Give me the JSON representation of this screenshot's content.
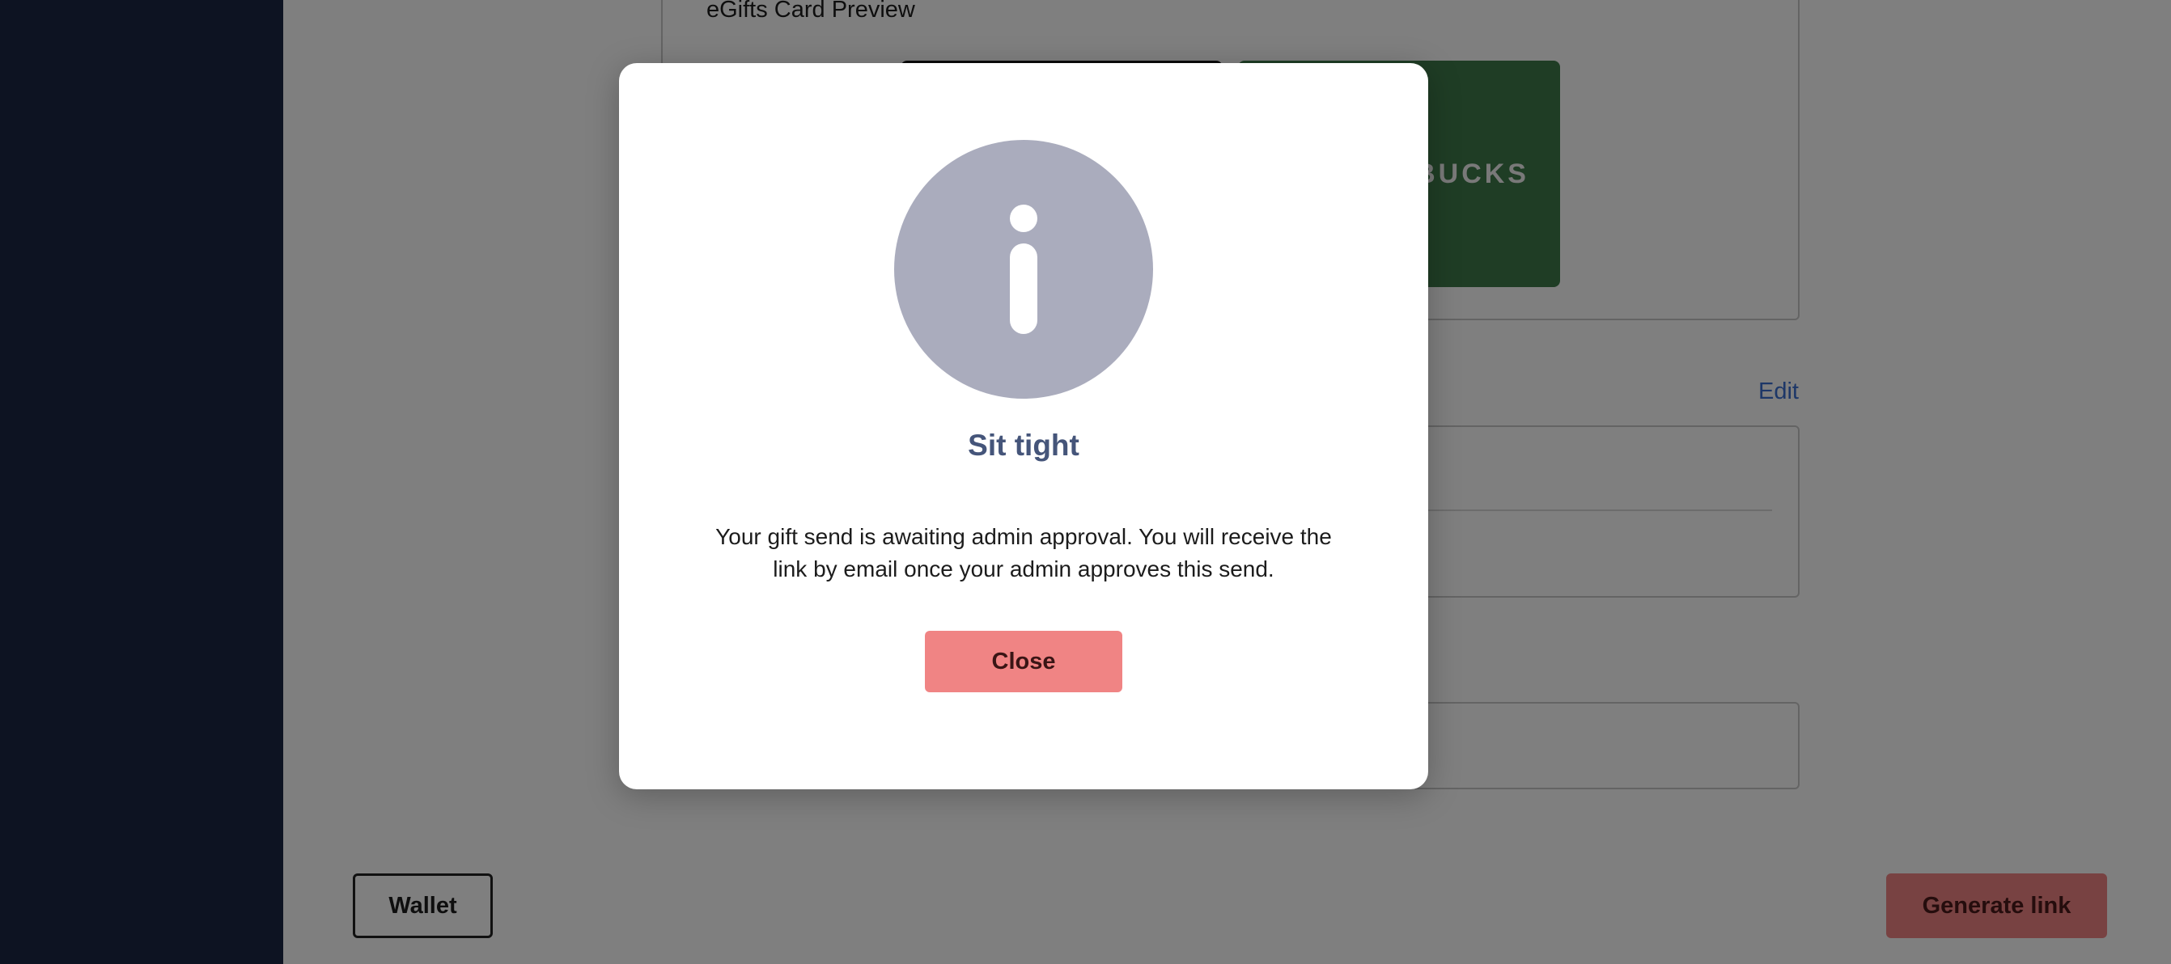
{
  "background": {
    "preview": {
      "title": "eGifts Card Preview",
      "cards": [
        {
          "label": "",
          "color": "#141414"
        },
        {
          "label": "BUCKS",
          "color": "#3e7a4a"
        }
      ]
    },
    "edit_label": "Edit",
    "wallet_label": "Wallet",
    "generate_label": "Generate link"
  },
  "modal": {
    "icon": "info-icon",
    "title": "Sit tight",
    "message": "Your gift send is awaiting admin approval. You will receive the link by email once your admin approves this send.",
    "close_label": "Close"
  },
  "colors": {
    "sidebar": "#1b2744",
    "accent": "#f08484",
    "title": "#45557a",
    "icon": "#aaacbd",
    "link": "#3b6fd1"
  }
}
